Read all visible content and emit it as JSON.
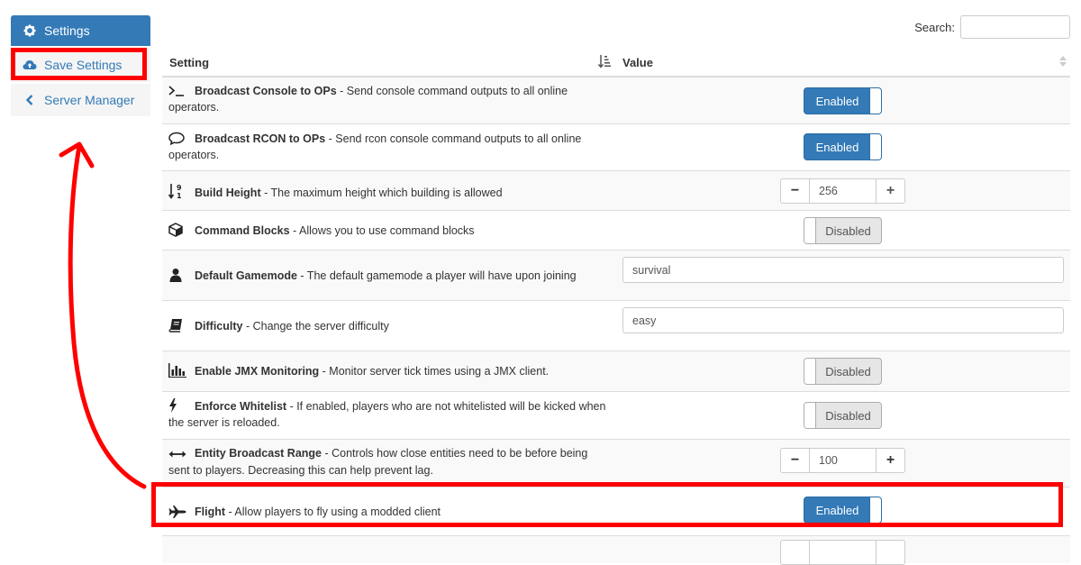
{
  "sidebar": {
    "items": [
      {
        "label": "Settings",
        "icon": "gear-icon"
      },
      {
        "label": "Save Settings",
        "icon": "cloud-upload-icon"
      },
      {
        "label": "Server Manager",
        "icon": "chevron-left-icon"
      }
    ]
  },
  "search": {
    "label": "Search:",
    "value": ""
  },
  "table": {
    "headers": {
      "setting": "Setting",
      "value": "Value"
    },
    "rows": [
      {
        "name": "Broadcast Console to OPs",
        "desc": " - Send console command outputs to all online operators.",
        "icon": "terminal-icon",
        "control": "toggle",
        "value": "Enabled"
      },
      {
        "name": "Broadcast RCON to OPs",
        "desc": " - Send rcon console command outputs to all online operators.",
        "icon": "comment-icon",
        "control": "toggle",
        "value": "Enabled"
      },
      {
        "name": "Build Height",
        "desc": " - The maximum height which building is allowed",
        "icon": "sort-numeric-icon",
        "control": "stepper",
        "value": "256"
      },
      {
        "name": "Command Blocks",
        "desc": " - Allows you to use command blocks",
        "icon": "cube-icon",
        "control": "toggle",
        "value": "Disabled"
      },
      {
        "name": "Default Gamemode",
        "desc": " - The default gamemode a player will have upon joining",
        "icon": "user-icon",
        "control": "text",
        "value": "survival"
      },
      {
        "name": "Difficulty",
        "desc": " - Change the server difficulty",
        "icon": "book-icon",
        "control": "text",
        "value": "easy"
      },
      {
        "name": "Enable JMX Monitoring",
        "desc": " - Monitor server tick times using a JMX client.",
        "icon": "bar-chart-icon",
        "control": "toggle",
        "value": "Disabled"
      },
      {
        "name": "Enforce Whitelist",
        "desc": " - If enabled, players who are not whitelisted will be kicked when the server is reloaded.",
        "icon": "bolt-icon",
        "control": "toggle",
        "value": "Disabled"
      },
      {
        "name": "Entity Broadcast Range",
        "desc": " - Controls how close entities need to be before being sent to players. Decreasing this can help prevent lag.",
        "icon": "arrows-h-icon",
        "control": "stepper",
        "value": "100"
      },
      {
        "name": "Flight",
        "desc": " - Allow players to fly using a modded client",
        "icon": "plane-icon",
        "control": "toggle",
        "value": "Enabled"
      }
    ]
  },
  "colors": {
    "primary": "#337ab7",
    "annotation": "#ff0000",
    "stripe": "#f9f9f9"
  }
}
